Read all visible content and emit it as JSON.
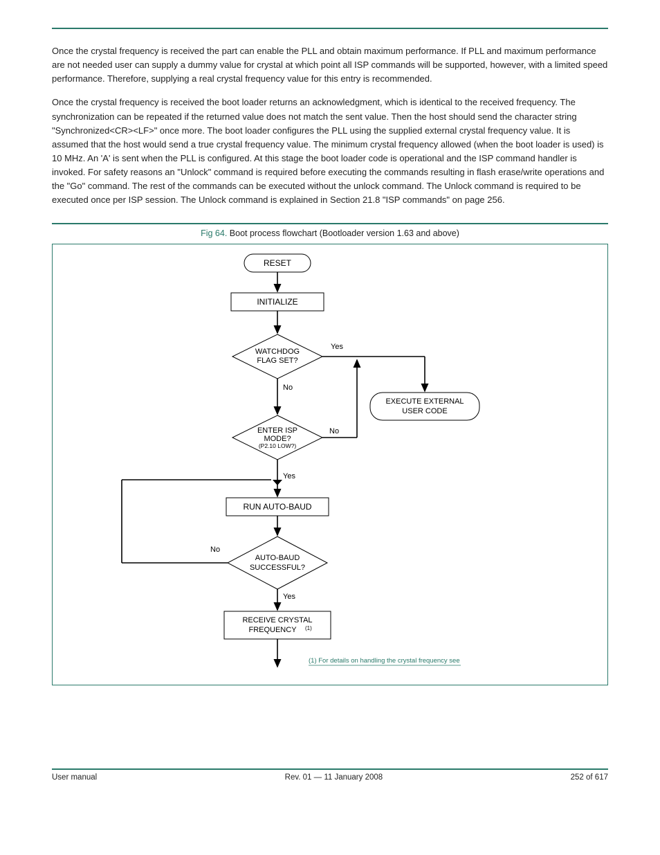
{
  "paragraphs": {
    "p1": "Once the crystal frequency is received the part can enable the PLL and obtain maximum performance. If PLL and maximum performance are not needed user can supply a dummy value for crystal at which point all ISP commands will be supported, however, with a limited speed performance. Therefore, supplying a real crystal frequency value for this entry is recommended.",
    "p2": "Once the crystal frequency is received the boot loader returns an acknowledgment, which is identical to the received frequency. The synchronization can be repeated if the returned value does not match the sent value. Then the host should send the character string \"Synchronized<CR><LF>\" once more. The boot loader configures the PLL using the supplied external crystal frequency value. It is assumed that the host would send a true crystal frequency value. The minimum crystal frequency allowed (when the boot loader is used) is 10 MHz. An 'A' is sent when the PLL is configured. At this stage the boot loader code is operational and the ISP command handler is invoked. For safety reasons an \"Unlock\" command is required before executing the commands resulting in flash erase/write operations and the \"Go\" command. The rest of the commands can be executed without the unlock command. The Unlock command is required to be executed once per ISP session. The Unlock command is explained in Section 21.8 \"ISP commands\" on page 256."
  },
  "figure": {
    "number": "Fig 64.",
    "caption": "Boot process flowchart (Bootloader version 1.63 and above)"
  },
  "flow": {
    "reset": "RESET",
    "init": "INITIALIZE",
    "watchdog": "WATCHDOG\nFLAG SET?",
    "yes1": "Yes",
    "no1": "No",
    "exec1": "EXECUTE EXTERNAL",
    "exec2": "USER CODE",
    "isp1": "ENTER ISP",
    "isp2": "MODE?",
    "isp3": "(P2.10 LOW?)",
    "no2": "No",
    "yes2": "Yes",
    "autobaud": "RUN AUTO-BAUD",
    "autoq1": "AUTO-BAUD",
    "autoq2": "SUCCESSFUL?",
    "no3": "No",
    "yes3": "Yes",
    "recv1": "RECEIVE CRYSTAL",
    "recv2": "FREQUENCY"
  },
  "footnote": "(1) For details on handling the crystal frequency see",
  "footer": {
    "left": "User manual",
    "center": "Rev. 01 — 11 January 2008",
    "right": "252 of 617"
  }
}
